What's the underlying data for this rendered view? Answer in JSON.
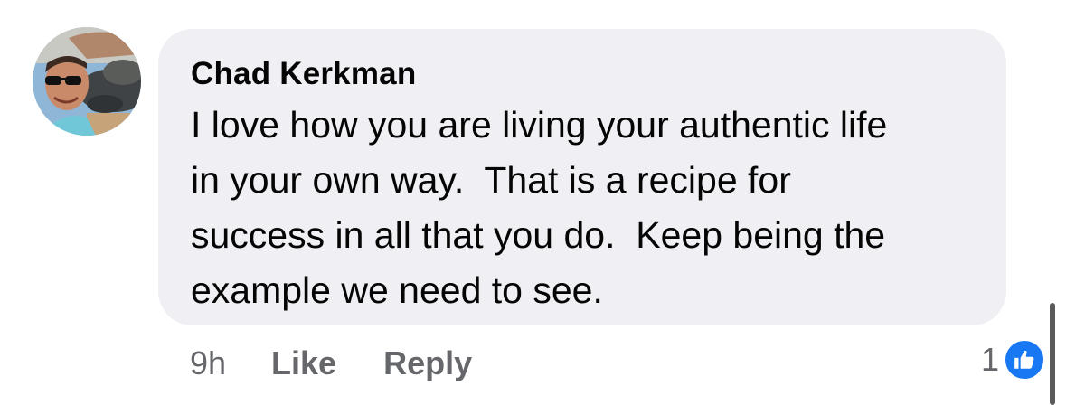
{
  "comment": {
    "author": "Chad Kerkman",
    "text": "I love how you are living your authentic life\nin your own way.  That is a recipe for\nsuccess in all that you do.  Keep being the\nexample we need to see.",
    "timestamp": "9h",
    "like_label": "Like",
    "reply_label": "Reply",
    "reaction_count": "1",
    "reaction_type": "like-icon"
  },
  "colors": {
    "bubble_bg": "#f0f0f4",
    "text": "#050505",
    "meta_text": "#65676b",
    "like_blue": "#1877f2"
  }
}
